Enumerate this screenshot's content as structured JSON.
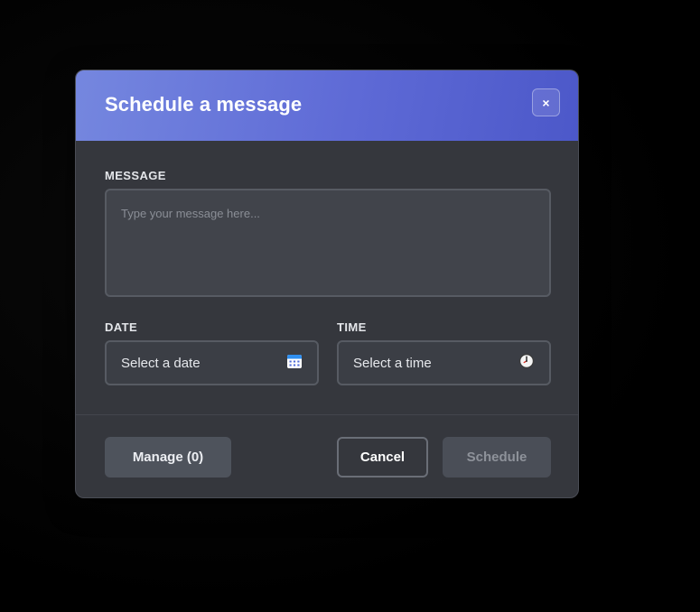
{
  "dialog": {
    "title": "Schedule a message",
    "close_label": "×"
  },
  "message": {
    "label": "MESSAGE",
    "placeholder": "Type your message here...",
    "value": ""
  },
  "date": {
    "label": "DATE",
    "placeholder": "Select a date",
    "icon": "calendar-icon"
  },
  "time": {
    "label": "TIME",
    "placeholder": "Select a time",
    "icon": "clock-icon"
  },
  "footer": {
    "manage_label": "Manage (0)",
    "cancel_label": "Cancel",
    "schedule_label": "Schedule"
  },
  "colors": {
    "header_start": "#7587df",
    "header_end": "#4c58c9",
    "dialog_bg": "#35373d"
  }
}
